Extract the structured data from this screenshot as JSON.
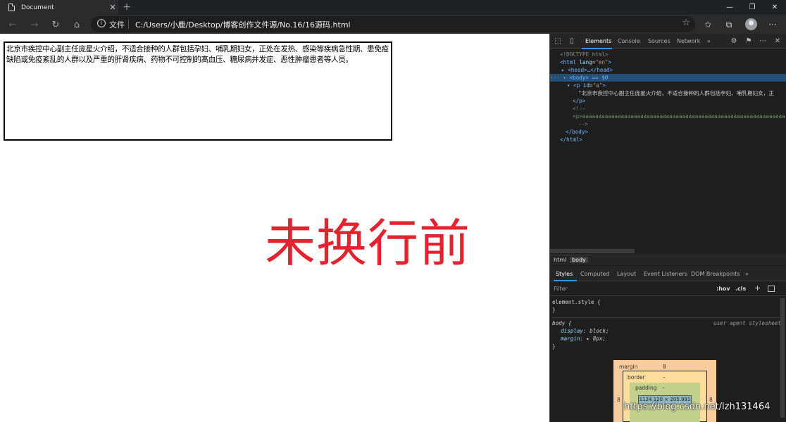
{
  "browser": {
    "tab_title": "Document",
    "tab_close": "✕",
    "new_tab": "+",
    "window_controls": [
      "—",
      "❐",
      "✕"
    ],
    "address": {
      "scheme_label": "文件",
      "url": "C:/Users/小鹿/Desktop/博客创作文件源/No.16/16源码.html"
    }
  },
  "page": {
    "paragraph_text": "北京市疾控中心副主任庞星火介绍，不适合接种的人群包括孕妇、哺乳期妇女，正处在发热、感染等疾病急性期、患免疫缺陷或免疫紊乱的人群以及严重的肝肾疾病、药物不可控制的高血压、糖尿病并发症、恶性肿瘤患者等人员。",
    "annotation": "未换行前"
  },
  "devtools": {
    "tabs": [
      "Elements",
      "Console",
      "Sources",
      "Network",
      "»"
    ],
    "active_tab": "Elements",
    "dom": {
      "doctype": "<!DOCTYPE html>",
      "html_open_tag": "html",
      "html_attr_name": "lang",
      "html_attr_value": "\"en\"",
      "head": "<head>…</head>",
      "body_line": "<body> == $0",
      "p_tag": "p",
      "p_attr_name": "id",
      "p_attr_value": "\"a\"",
      "p_text": "\"北京市疾控中心副主任庞星火介绍，不适合接种的人群包括孕妇、哺乳期妇女，正",
      "p_close": "</p>",
      "comment_open": "<!--",
      "comment_body": "<p>aaaaaaaaaaaaaaaaaaaaaaaaaaaaaaaaaaaaaaaaaaaaaaaaaaaaaaaaaaaaaaa",
      "comment_close": "-->",
      "body_close": "</body>",
      "html_close": "</html>"
    },
    "breadcrumbs": [
      "html",
      "body"
    ],
    "subtabs": [
      "Styles",
      "Computed",
      "Layout",
      "Event Listeners",
      "DOM Breakpoints",
      "»"
    ],
    "active_subtab": "Styles",
    "filter_placeholder": "Filter",
    "hov_label": ":hov",
    "cls_label": ".cls",
    "plus_label": "+",
    "rules": {
      "element_style_selector": "element.style {",
      "element_style_close": "}",
      "body_selector": "body {",
      "body_origin": "user agent stylesheet",
      "display_prop": "display",
      "display_value": "block;",
      "margin_prop": "margin",
      "margin_value": "▸ 8px;",
      "body_close": "}"
    },
    "box_model": {
      "margin_label": "margin",
      "margin_top": "8",
      "margin_left": "8",
      "margin_right": "8",
      "border_label": "border",
      "border_value": "–",
      "padding_label": "padding",
      "padding_value": "–",
      "content_size": "1124.120 × 205.991"
    }
  },
  "watermark": "https://blog.csdn.net/lzh131464"
}
